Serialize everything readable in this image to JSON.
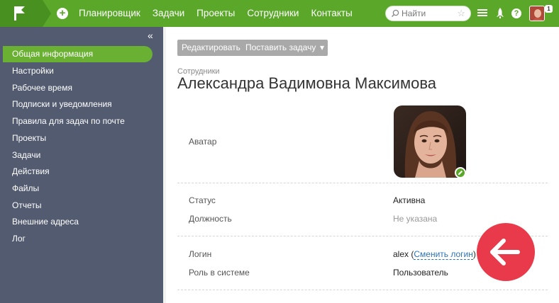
{
  "nav": {
    "items": [
      "Планировщик",
      "Задачи",
      "Проекты",
      "Сотрудники",
      "Контакты"
    ]
  },
  "search": {
    "placeholder": "Найти"
  },
  "topbar": {
    "notification_count": "1",
    "help_label": "?"
  },
  "icons": {
    "logo": "flag-logo-icon",
    "add": "plus-circle-icon",
    "search": "search-icon",
    "favorite": "star-icon",
    "menu": "hamburger-menu-icon",
    "launch": "rocket-icon",
    "help": "help-icon",
    "edit_avatar": "pencil-icon",
    "collapse": "double-chevron-left-icon",
    "arrow": "arrow-left-icon"
  },
  "sidebar": {
    "collapse_label": "«",
    "items": [
      "Общая информация",
      "Настройки",
      "Рабочее время",
      "Подписки и уведомления",
      "Правила для задач по почте",
      "Проекты",
      "Задачи",
      "Действия",
      "Файлы",
      "Отчеты",
      "Внешние адреса",
      "Лог"
    ],
    "active_index": 0
  },
  "toolbar": {
    "edit_label": "Редактировать",
    "assign_label": "Поставить задачу",
    "more_label": "▾"
  },
  "breadcrumb": "Сотрудники",
  "page_title": "Александра Вадимовна Максимова",
  "profile": {
    "avatar_label": "Аватар",
    "status_label": "Статус",
    "status_value": "Активна",
    "position_label": "Должность",
    "position_value": "Не указана",
    "login_label": "Логин",
    "login_value": "alex",
    "login_paren_open": "(",
    "login_change_link": "Сменить логин",
    "login_paren_close": ")",
    "role_label": "Роль в системе",
    "role_value": "Пользователь"
  },
  "colors": {
    "topbar": "#5aa72a",
    "sidebar": "#535b70",
    "sidebar_active": "#6ab033",
    "accent_red": "#e83a4a",
    "link": "#2d74b5"
  }
}
